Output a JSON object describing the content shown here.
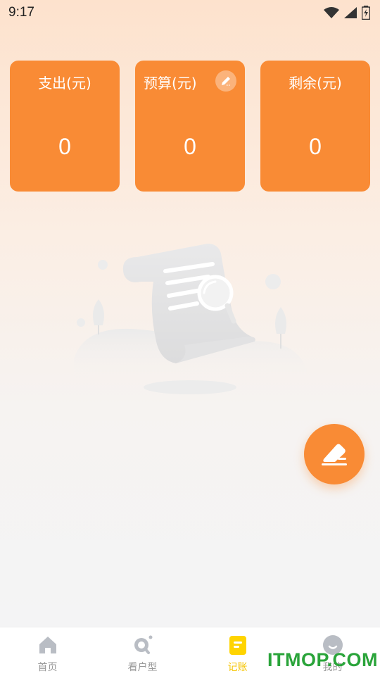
{
  "status_bar": {
    "time": "9:17"
  },
  "cards": [
    {
      "title": "支出(元)",
      "value": "0"
    },
    {
      "title": "预算(元)",
      "value": "0"
    },
    {
      "title": "剩余(元)",
      "value": "0"
    }
  ],
  "tabbar": {
    "items": [
      {
        "label": "首页",
        "icon": "home-icon"
      },
      {
        "label": "看户型",
        "icon": "search-icon"
      },
      {
        "label": "记账",
        "icon": "notebook-icon",
        "active": true
      },
      {
        "label": "我的",
        "icon": "profile-icon"
      }
    ]
  },
  "watermark": "ITMOP.COM",
  "colors": {
    "accent": "#f98b35",
    "active_tab": "#f5c400",
    "watermark": "#2aa43a"
  }
}
